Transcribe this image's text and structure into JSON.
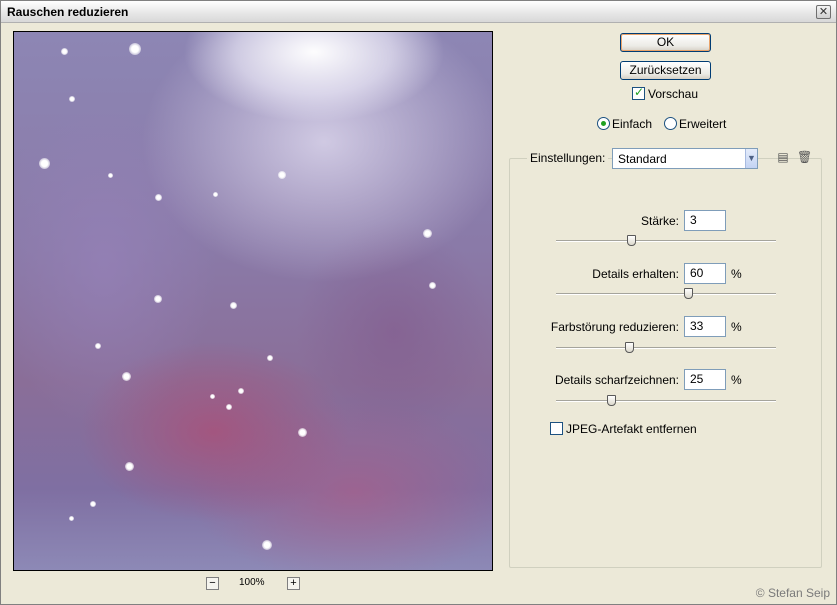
{
  "window": {
    "title": "Rauschen reduzieren",
    "close_glyph": "✕"
  },
  "preview": {
    "zoom_level": "100%",
    "zoom_out": "−",
    "zoom_in": "+"
  },
  "buttons": {
    "ok": "OK",
    "reset": "Zurücksetzen"
  },
  "preview_toggle": {
    "label": "Vorschau",
    "checked": true
  },
  "mode": {
    "options": [
      "Einfach",
      "Erweitert"
    ],
    "selected": "Einfach"
  },
  "settings": {
    "label": "Einstellungen:",
    "selected": "Standard",
    "save_icon": "save-preset-icon",
    "delete_icon": "trash-icon"
  },
  "sliders": [
    {
      "label": "Stärke:",
      "value": "3",
      "unit": "",
      "fraction": 0.34
    },
    {
      "label": "Details erhalten:",
      "value": "60",
      "unit": "%",
      "fraction": 0.6
    },
    {
      "label": "Farbstörung reduzieren:",
      "value": "33",
      "unit": "%",
      "fraction": 0.33
    },
    {
      "label": "Details scharfzeichnen:",
      "value": "25",
      "unit": "%",
      "fraction": 0.25
    }
  ],
  "jpeg": {
    "label": "JPEG-Artefakt entfernen",
    "checked": false
  },
  "copyright": "© Stefan Seip",
  "colors": {
    "title_bg": "#e6e6e6",
    "dialog_bg": "#ece9d8",
    "check_accent": "#21a121",
    "input_border": "#7f9db9"
  }
}
